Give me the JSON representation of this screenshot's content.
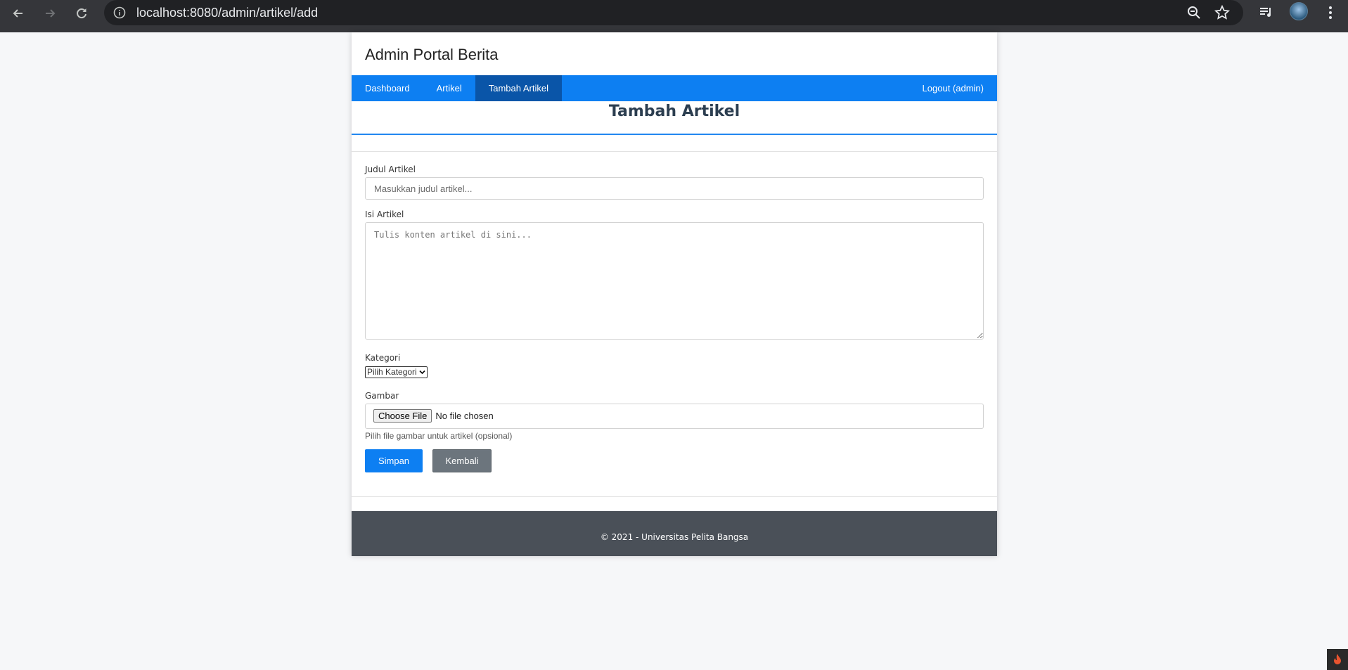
{
  "browser": {
    "url": "localhost:8080/admin/artikel/add"
  },
  "site": {
    "title": "Admin Portal Berita"
  },
  "nav": {
    "items": [
      {
        "label": "Dashboard"
      },
      {
        "label": "Artikel"
      },
      {
        "label": "Tambah Artikel"
      }
    ],
    "logout_label": "Logout (admin)"
  },
  "page_heading": "Tambah Artikel",
  "form": {
    "title_label": "Judul Artikel",
    "title_placeholder": "Masukkan judul artikel...",
    "content_label": "Isi Artikel",
    "content_placeholder": "Tulis konten artikel di sini...",
    "category_label": "Kategori",
    "category_selected": "Pilih Kategori",
    "image_label": "Gambar",
    "choose_file_label": "Choose File",
    "no_file_text": "No file chosen",
    "image_hint": "Pilih file gambar untuk artikel (opsional)",
    "submit_label": "Simpan",
    "back_label": "Kembali"
  },
  "footer": {
    "text": "© 2021 - Universitas Pelita Bangsa"
  },
  "icons": {
    "back": "arrow-left-icon",
    "forward": "arrow-right-icon",
    "reload": "reload-icon",
    "site_info": "info-icon",
    "zoom": "zoom-out-icon",
    "bookmark": "star-icon",
    "media": "playlist-icon",
    "menu": "kebab-menu-icon"
  },
  "colors": {
    "nav_bg": "#0d7ff2",
    "nav_active": "#0a55a8",
    "footer_bg": "#4a5058",
    "primary": "#0d7ff2",
    "secondary": "#6c757d"
  }
}
